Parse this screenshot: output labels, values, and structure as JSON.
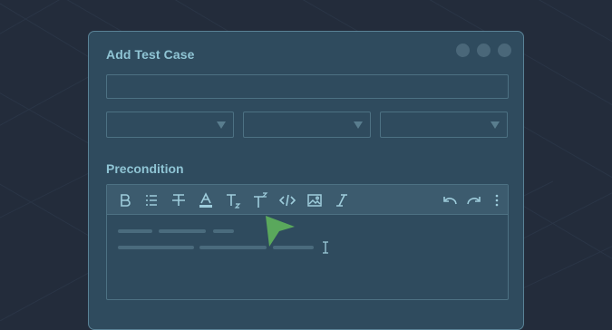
{
  "dialog": {
    "title": "Add Test Case",
    "title_input": {
      "value": "",
      "placeholder": ""
    },
    "selects": [
      {
        "value": ""
      },
      {
        "value": ""
      },
      {
        "value": ""
      }
    ],
    "precondition": {
      "label": "Precondition",
      "toolbar": {
        "left_icons": [
          "bold-icon",
          "bulleted-list-icon",
          "strikethrough-icon",
          "text-color-icon",
          "subscript-icon",
          "superscript-icon",
          "code-icon",
          "image-icon",
          "italic-icon"
        ],
        "right_icons": [
          "undo-icon",
          "redo-icon",
          "more-icon"
        ]
      },
      "content": ""
    }
  },
  "colors": {
    "background": "#232c3b",
    "panel": "#2f4b5e",
    "accent_text": "#8fc4d4",
    "cursor_green": "#5aa85c"
  }
}
